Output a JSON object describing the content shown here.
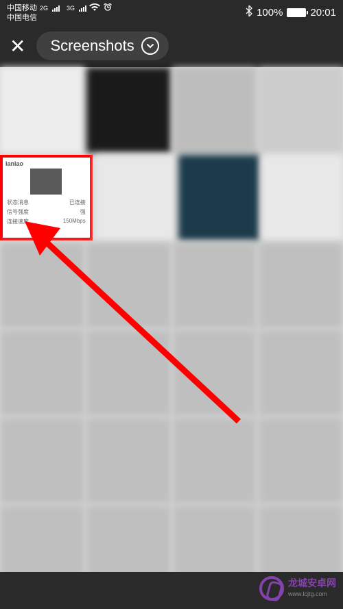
{
  "statusbar": {
    "carrier1": "中国移动",
    "carrier2": "中国电信",
    "net1": "2G",
    "net2": "3G",
    "battery": "100%",
    "time": "20:01"
  },
  "header": {
    "album": "Screenshots"
  },
  "selected": {
    "title": "lanlao",
    "rows": [
      {
        "k": "状态消息",
        "v": "已连接"
      },
      {
        "k": "信号强度",
        "v": "强"
      },
      {
        "k": "连接速度",
        "v": "150Mbps"
      }
    ]
  },
  "watermark": {
    "brand": "龙城安卓网",
    "url": "www.lcjtg.com"
  }
}
